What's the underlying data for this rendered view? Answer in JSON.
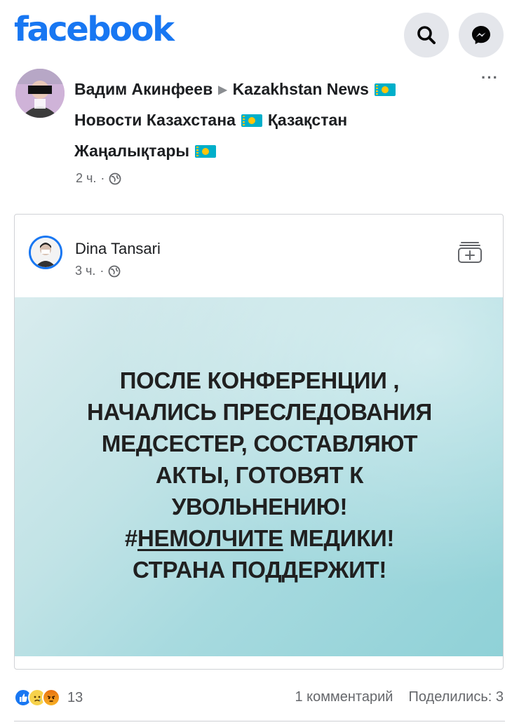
{
  "app": {
    "logo": "facebook",
    "brand_color": "#1877f2"
  },
  "header": {
    "icons": [
      "search-icon",
      "messenger-icon"
    ]
  },
  "post": {
    "author": "Вадим Акинфеев",
    "group_line1": "Kazakhstan News",
    "group_line2a": "Новости Казахстана",
    "group_line2b": "Қазақстан",
    "group_line3": "Жаңалықтары",
    "time": "2 ч.",
    "dot": "·",
    "more_label": "···"
  },
  "shared": {
    "author": "Dina Tansari",
    "time": "3 ч.",
    "dot": "·",
    "image_text": {
      "line1": "ПОСЛЕ КОНФЕРЕНЦИИ ,",
      "line2": "НАЧАЛИСЬ ПРЕСЛЕДОВАНИЯ",
      "line3": "МЕДСЕСТЕР, СОСТАВЛЯЮТ",
      "line4": "АКТЫ, ГОТОВЯТ К",
      "line5": "УВОЛЬНЕНИЮ!",
      "line6_hash": "#",
      "line6_tag": "НЕМОЛЧИТЕ",
      "line6_rest": " МЕДИКИ!",
      "line7": "СТРАНА ПОДДЕРЖИТ!"
    }
  },
  "footer": {
    "reactions": [
      "like-icon",
      "sad-icon",
      "angry-icon"
    ],
    "reaction_count": "13",
    "comments": "1 комментарий",
    "shares": "Поделились: 3"
  }
}
